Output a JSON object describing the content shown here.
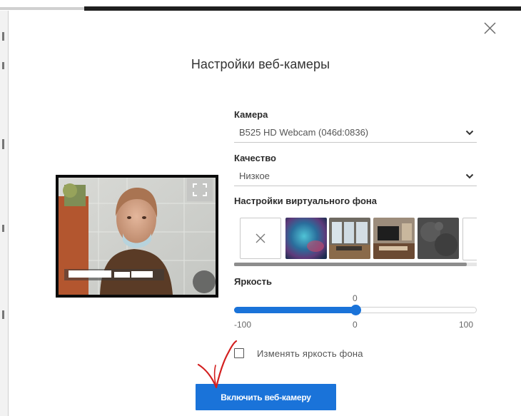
{
  "dialog": {
    "title": "Настройки веб-камеры",
    "close_icon": "close-icon"
  },
  "camera": {
    "label": "Камера",
    "selected": "B525 HD Webcam (046d:0836)"
  },
  "quality": {
    "label": "Качество",
    "selected": "Низкое"
  },
  "virtual_background": {
    "label": "Настройки виртуального фона",
    "items": [
      {
        "name": "none",
        "icon": "close-icon"
      },
      {
        "name": "blur-aurora"
      },
      {
        "name": "office-windows"
      },
      {
        "name": "living-room-tv"
      },
      {
        "name": "dark-texture"
      },
      {
        "name": "partial-next"
      }
    ],
    "scroll_fraction": 0.96
  },
  "brightness": {
    "label": "Яркость",
    "value": "0",
    "value_number": 0,
    "min": "-100",
    "mid": "0",
    "max": "100",
    "min_number": -100,
    "max_number": 100
  },
  "background_brightness": {
    "label": "Изменять яркость фона",
    "checked": false
  },
  "primary_button": {
    "label": "Включить веб-камеру"
  },
  "colors": {
    "accent": "#1a73d9",
    "annotation": "#d32020"
  }
}
